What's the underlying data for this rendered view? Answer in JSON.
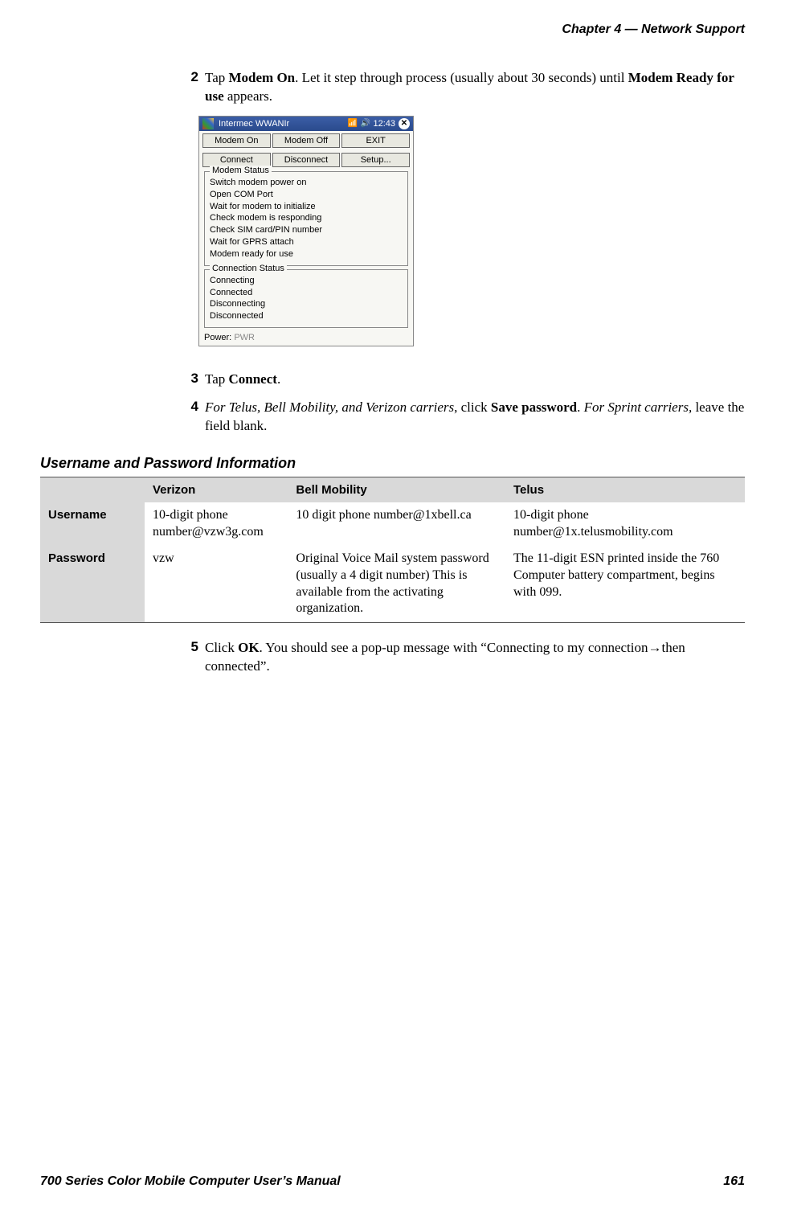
{
  "header": {
    "chapter": "Chapter  4  —  Network Support"
  },
  "steps": {
    "s2": {
      "num": "2",
      "pre": "Tap ",
      "bold1": "Modem On",
      "mid": ". Let it step through process (usually about 30 seconds) until ",
      "bold2": "Modem Ready for use",
      "post": " appears."
    },
    "s3": {
      "num": "3",
      "pre": "Tap ",
      "bold": "Connect",
      "post": "."
    },
    "s4": {
      "num": "4",
      "italic1": "For Telus, Bell Mobility, and Verizon carriers",
      "mid1": ", click ",
      "bold": "Save password",
      "mid2": ". ",
      "italic2": "For Sprint carriers,",
      "post": " leave the field blank."
    },
    "s5": {
      "num": "5",
      "pre": "Click ",
      "bold": "OK",
      "post": ". You should see a pop-up message with “Connecting to my connection→then connected”."
    }
  },
  "screenshot": {
    "title": "Intermec WWANIr",
    "time": "12:43",
    "buttons_row1": [
      "Modem On",
      "Modem Off",
      "EXIT"
    ],
    "buttons_row2": [
      "Connect",
      "Disconnect",
      "Setup..."
    ],
    "modem_status_label": "Modem Status",
    "modem_status_lines": [
      "Switch modem power on",
      "Open COM Port",
      "Wait for modem to initialize",
      "Check modem is responding",
      "Check SIM card/PIN number",
      "Wait for GPRS attach",
      "Modem ready for use"
    ],
    "conn_status_label": "Connection Status",
    "conn_status_lines": [
      "Connecting",
      "Connected",
      "Disconnecting",
      "Disconnected"
    ],
    "power_label": "Power:",
    "power_value": "PWR"
  },
  "table": {
    "title": "Username and Password Information",
    "headers": [
      "",
      "Verizon",
      "Bell Mobility",
      "Telus"
    ],
    "rows": [
      {
        "label": "Username",
        "cells": [
          "10-digit phone number@vzw3g.com",
          "10 digit phone number@1xbell.ca",
          "10-digit phone number@1x.telusmobility.com"
        ]
      },
      {
        "label": "Password",
        "cells": [
          "vzw",
          "Original Voice Mail system password (usually a 4 digit number) This is available from the activating organization.",
          "The 11-digit ESN printed inside the 760 Computer battery compartment, begins with 099."
        ]
      }
    ]
  },
  "footer": {
    "left": "700 Series Color Mobile Computer User’s Manual",
    "right": "161"
  }
}
